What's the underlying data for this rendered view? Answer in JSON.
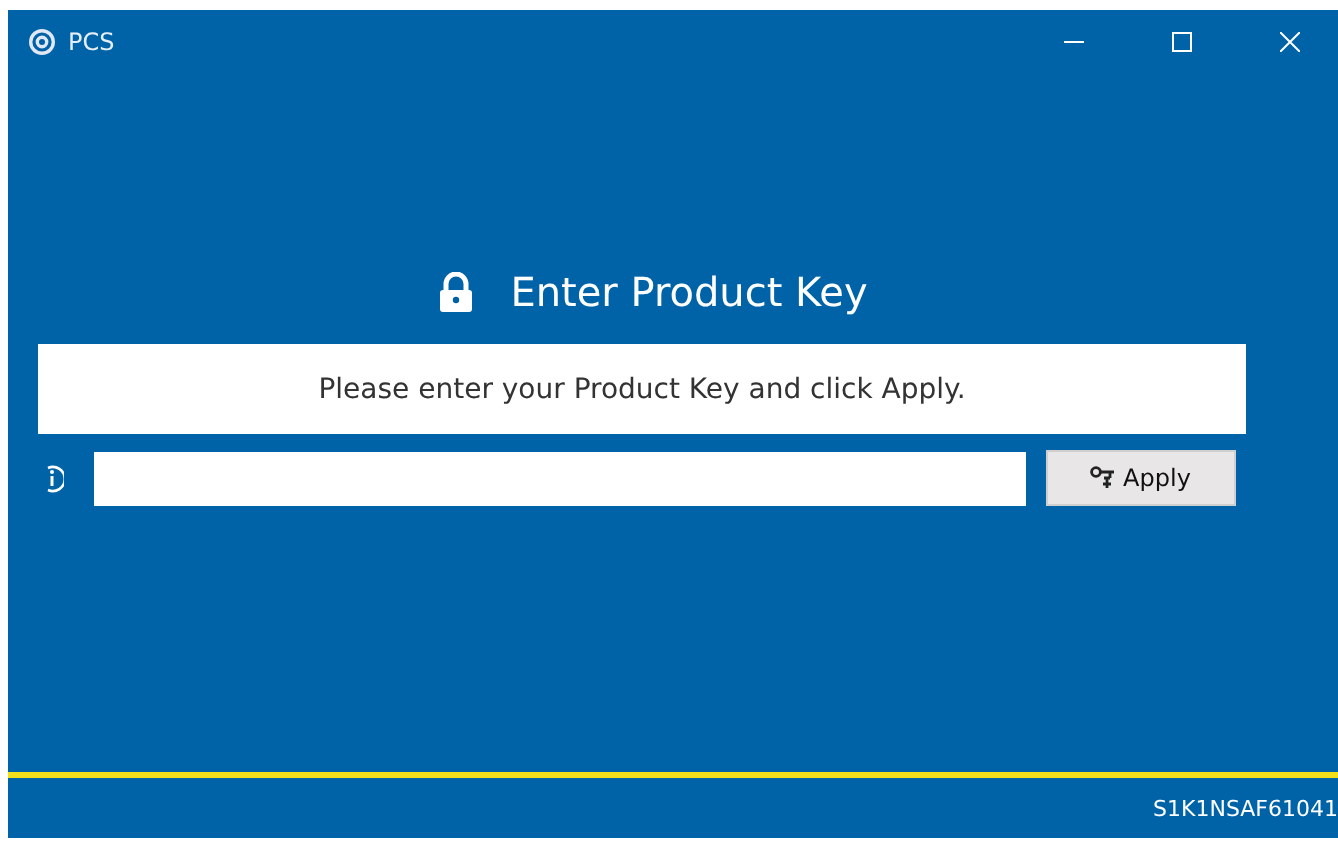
{
  "window": {
    "title": "PCS"
  },
  "heading": "Enter Product Key",
  "message": "Please enter your Product Key and click Apply.",
  "apply_button": "Apply",
  "status_bar": "S1K1NSAF61041"
}
